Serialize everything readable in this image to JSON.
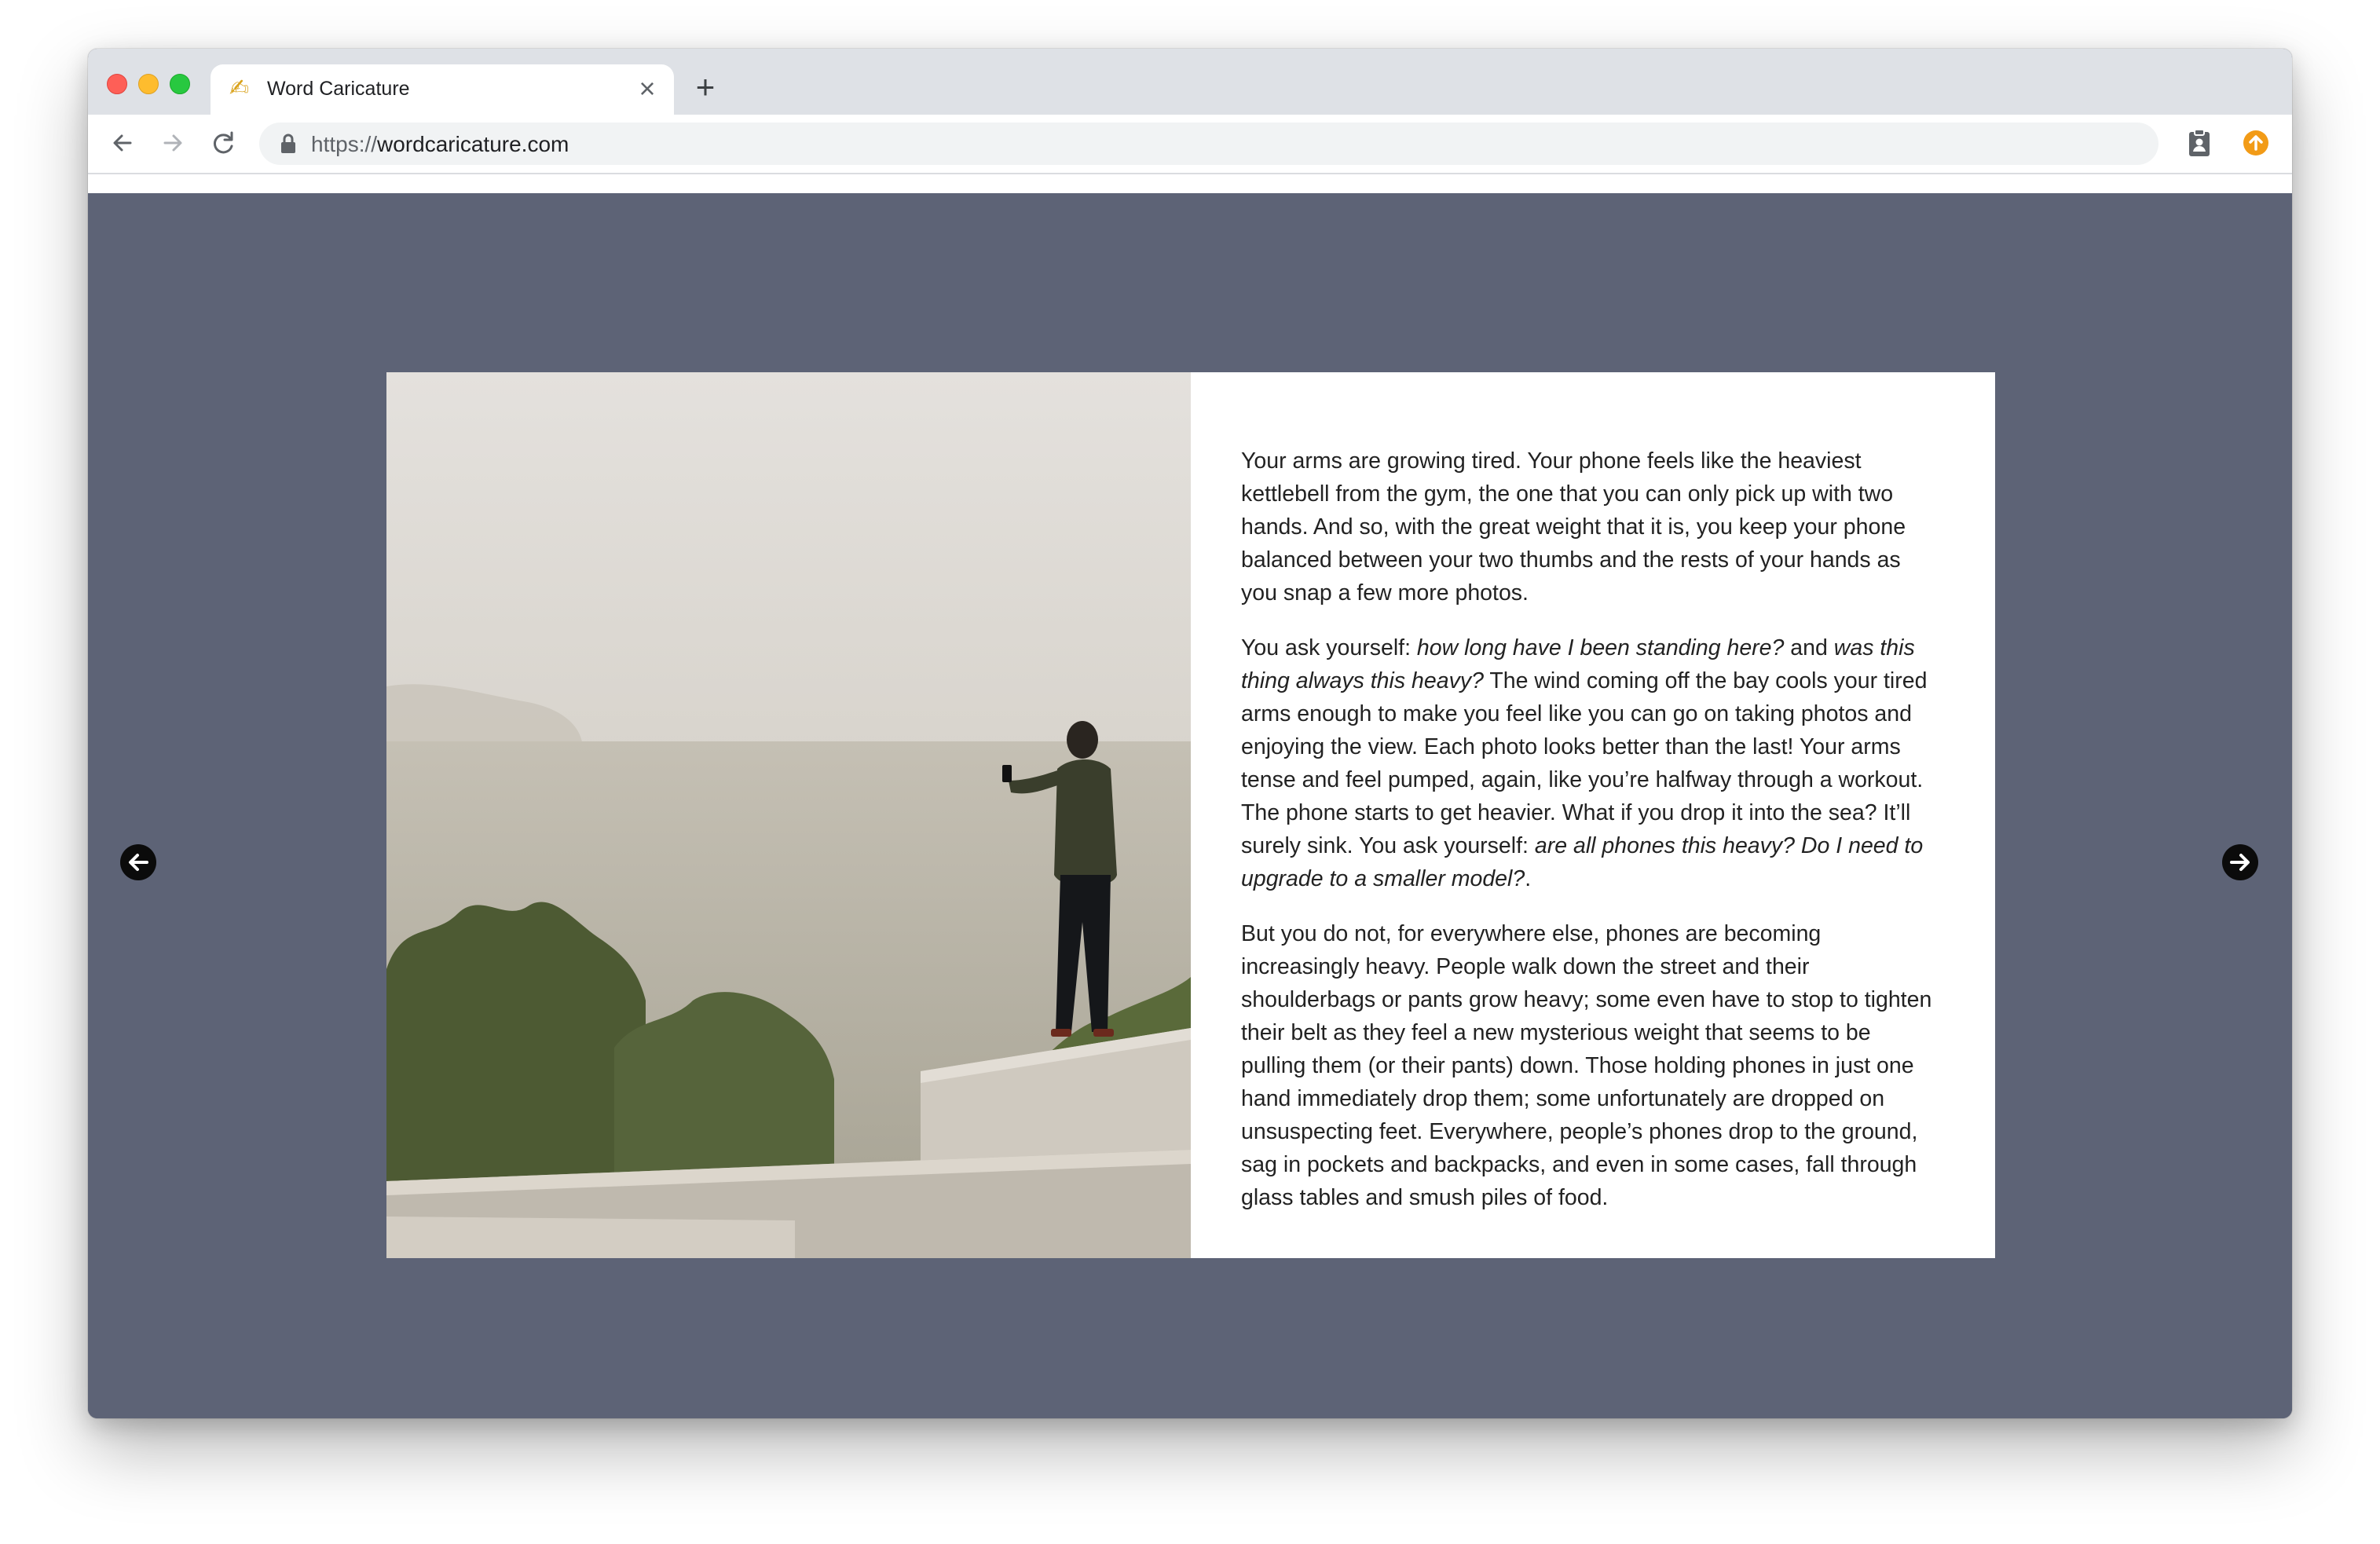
{
  "browser": {
    "tab": {
      "title": "Word Caricature",
      "favicon": "writing-hand-icon"
    },
    "url": {
      "scheme": "https://",
      "host": "wordcaricature.com"
    },
    "buttons": [
      "back-icon",
      "forward-icon",
      "reload-icon",
      "new-tab-icon",
      "close-tab-icon"
    ],
    "extensions": [
      "clipboard-icon",
      "update-icon"
    ],
    "colors": {
      "tabstrip": "#dee1e6",
      "page_background": "#5d6376",
      "update_badge": "#f29b17"
    }
  },
  "page": {
    "photo": {
      "description_icon": "photo-man-photographing-foggy-bay"
    },
    "paragraphs": {
      "p1": "Your arms are growing tired. Your phone feels like the heaviest kettlebell from the gym, the one that you can only pick up with two hands. And so, with the great weight that it is, you keep your phone balanced between your two thumbs and the rests of your hands as you snap a few more photos.",
      "p2_a": "You ask yourself: ",
      "p2_b": "how long have I been standing here?",
      "p2_c": " and ",
      "p2_d": "was this thing always this heavy?",
      "p2_e": " The wind coming off the bay cools your tired arms enough to make you feel like you can go on taking photos and enjoying the view. Each photo looks better than the last! Your arms tense and feel pumped, again, like you’re halfway through a workout. The phone starts to get heavier. What if you drop it into the sea? It’ll surely sink. You ask yourself: ",
      "p2_f": "are all phones this heavy? Do I need to upgrade to a smaller model?",
      "p2_g": ".",
      "p3": "But you do not, for everywhere else, phones are becoming increasingly heavy. People walk down the street and their shoulderbags or pants grow heavy; some even have to stop to tighten their belt as they feel a new mysterious weight that seems to be pulling them (or their pants) down. Those holding phones in just one hand immediately drop them; some unfortunately are dropped on unsuspecting feet. Everywhere, people’s phones drop to the ground, sag in pockets and backpacks, and even in some cases, fall through glass tables and smush piles of food."
    },
    "navigation": {
      "prev": "arrow-left-circle-icon",
      "next": "arrow-right-circle-icon"
    }
  }
}
